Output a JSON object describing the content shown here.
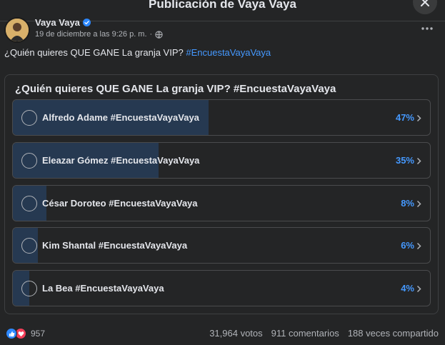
{
  "header": {
    "title": "Publicación de Vaya Vaya"
  },
  "post": {
    "author": "Vaya Vaya",
    "timestamp": "19 de diciembre a las 9:26 p. m.",
    "separator": "·",
    "text": "¿Quién quieres QUE GANE La granja VIP?",
    "hashtag": "#EncuestaVayaVaya"
  },
  "poll": {
    "question": "¿Quién quieres QUE GANE La granja VIP? #EncuestaVayaVaya",
    "options": [
      {
        "label": "Alfredo Adame #EncuestaVayaVaya",
        "percent": 47,
        "percent_text": "47%"
      },
      {
        "label": "Eleazar Gómez #EncuestaVayaVaya",
        "percent": 35,
        "percent_text": "35%"
      },
      {
        "label": "César Doroteo #EncuestaVayaVaya",
        "percent": 8,
        "percent_text": "8%"
      },
      {
        "label": "Kim Shantal #EncuestaVayaVaya",
        "percent": 6,
        "percent_text": "6%"
      },
      {
        "label": "La Bea #EncuestaVayaVaya",
        "percent": 4,
        "percent_text": "4%"
      }
    ]
  },
  "footer": {
    "reaction_count": "957",
    "votes": "31,964 votos",
    "comments": "911 comentarios",
    "shares": "188 veces compartido"
  },
  "colors": {
    "background": "#242526",
    "accent": "#4599ff",
    "fill": "#263951",
    "like": "#2d88ff",
    "love": "#f33e58"
  },
  "icons": [
    "close-icon",
    "verified-icon",
    "globe-icon",
    "more-icon",
    "radio-icon",
    "chevron-right-icon",
    "like-icon",
    "love-icon"
  ]
}
